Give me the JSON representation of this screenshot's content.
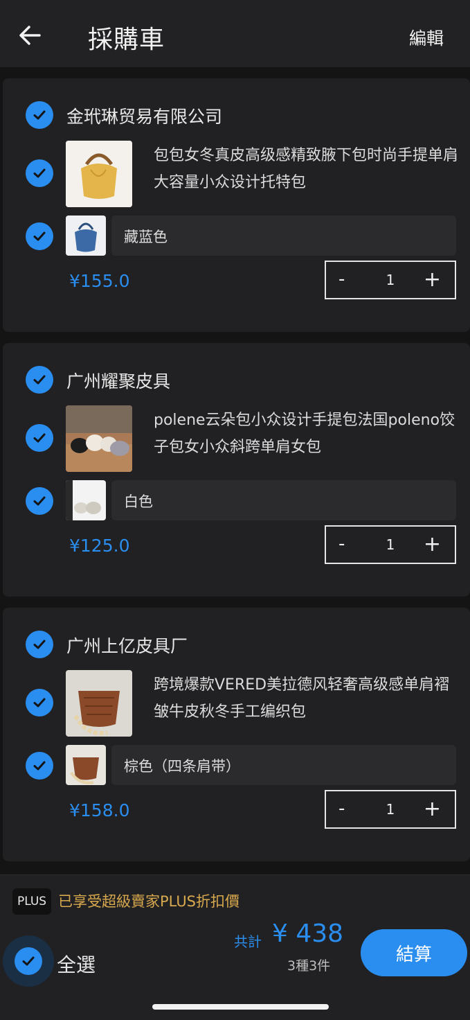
{
  "header": {
    "title": "採購車",
    "edit_label": "編輯"
  },
  "colors": {
    "accent": "#2a8ef0",
    "plus_text": "#d9a94e",
    "card_bg": "#212123",
    "page_bg": "#141414"
  },
  "shops": [
    {
      "name": "金玳琳贸易有限公司",
      "product_title": "包包女冬真皮高级感精致腋下包时尚手提单肩大容量小众设计托特包",
      "sku": "藏蓝色",
      "price": "¥155.0",
      "quantity": "1"
    },
    {
      "name": "广州耀聚皮具",
      "product_title": "polene云朵包小众设计手提包法国poleno饺子包女小众斜跨单肩女包",
      "sku": "白色",
      "price": "¥125.0",
      "quantity": "1"
    },
    {
      "name": "广州上亿皮具厂",
      "product_title": "跨境爆款VERED美拉德风轻奢高级感单肩褶皱牛皮秋冬手工编织包",
      "sku": "棕色（四条肩带）",
      "price": "¥158.0",
      "quantity": "1"
    }
  ],
  "stepper": {
    "minus": "-",
    "plus": "+"
  },
  "footer": {
    "plus_badge": "PLUS",
    "plus_text": "已享受超級賣家PLUS折扣價",
    "select_all": "全選",
    "total_label": "共計",
    "total_value": "¥ 438",
    "count": "3種3件",
    "checkout": "結算"
  }
}
